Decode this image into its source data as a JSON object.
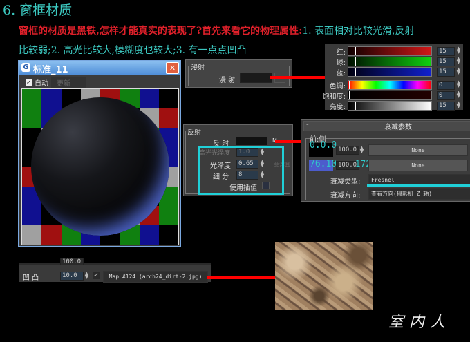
{
  "heading": "6. 窗框材质",
  "intro": {
    "red": "窗框的材质是黑铁,怎样才能真实的表现了?首先来看它的物理属性:",
    "cyan": "1. 表面相对比较光滑,反射",
    "line2": "比较弱;2. 高光比较大,模糊度也较大;3. 有一点点凹凸"
  },
  "preview": {
    "title": "标准_11",
    "auto_label": "自动",
    "update_label": "更新",
    "auto_checked": true
  },
  "diffuse_panel": {
    "group": "漫射",
    "label": "漫 射",
    "color": "#1a1a1a"
  },
  "color_picker": {
    "rows": [
      {
        "label": "红:",
        "value": "15"
      },
      {
        "label": "绿:",
        "value": "15"
      },
      {
        "label": "蓝:",
        "value": "15"
      },
      {
        "label": "色调:",
        "value": "0"
      },
      {
        "label": "饱和度:",
        "value": "0"
      },
      {
        "label": "亮度:",
        "value": "15"
      }
    ]
  },
  "reflection_panel": {
    "group": "反射",
    "reflect_label": "反 射",
    "m_label": "M",
    "l_label": "L",
    "hilight_label": "高光光泽度",
    "hilight_value": "1.0",
    "gloss_label": "光泽度",
    "gloss_value": "0.65",
    "subdiv_label": "细 分",
    "subdiv_value": "8",
    "interp_label": "使用插值",
    "fresnel_label": "菲涅耳"
  },
  "falloff_panel": {
    "title": "衰减参数",
    "collapse": "-",
    "group": "前:侧",
    "color1_value": "0.0.0",
    "amount1": "100.0",
    "map1": "None",
    "color2_value": "76.10",
    "amount2": "100.0",
    "color2_extra": "172",
    "map2": "None",
    "type_label": "衰减类型:",
    "type_value": "Fresnel",
    "dir_label": "衰减方向:",
    "dir_value": "查看方向(摄影机 Z 轴)"
  },
  "bump_row": {
    "label": "凹 凸",
    "amount": "10.0",
    "top_amount": "100.0",
    "checked": true,
    "map": "Map #124 (arch24_dirt-2.jpg)"
  },
  "watermark": "室内人"
}
